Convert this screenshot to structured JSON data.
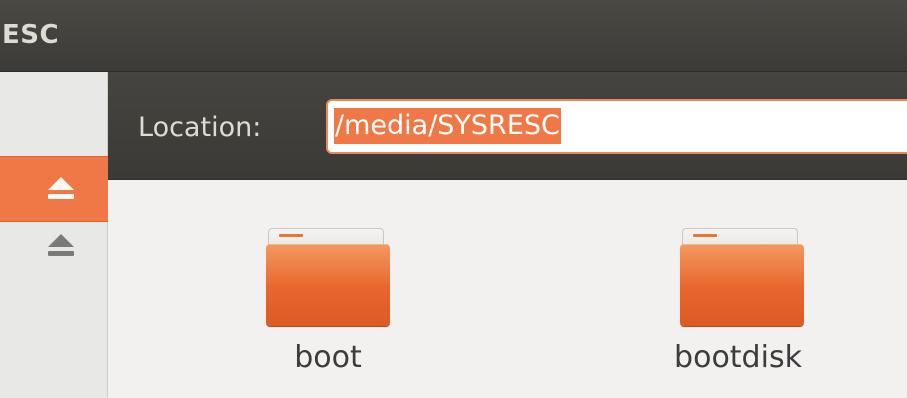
{
  "window": {
    "title": "ESC"
  },
  "sidebar": {
    "items": [
      {
        "icon": "eject-icon",
        "selected": true
      },
      {
        "icon": "eject-icon",
        "selected": false
      }
    ]
  },
  "location": {
    "label": "Location:",
    "value": "/media/SYSRESC"
  },
  "files": [
    {
      "name": "boot",
      "icon": "folder-icon"
    },
    {
      "name": "bootdisk",
      "icon": "folder-icon"
    }
  ],
  "colors": {
    "accent": "#f07746",
    "titlebar": "#3c3b37",
    "folder": "#e9652d"
  }
}
